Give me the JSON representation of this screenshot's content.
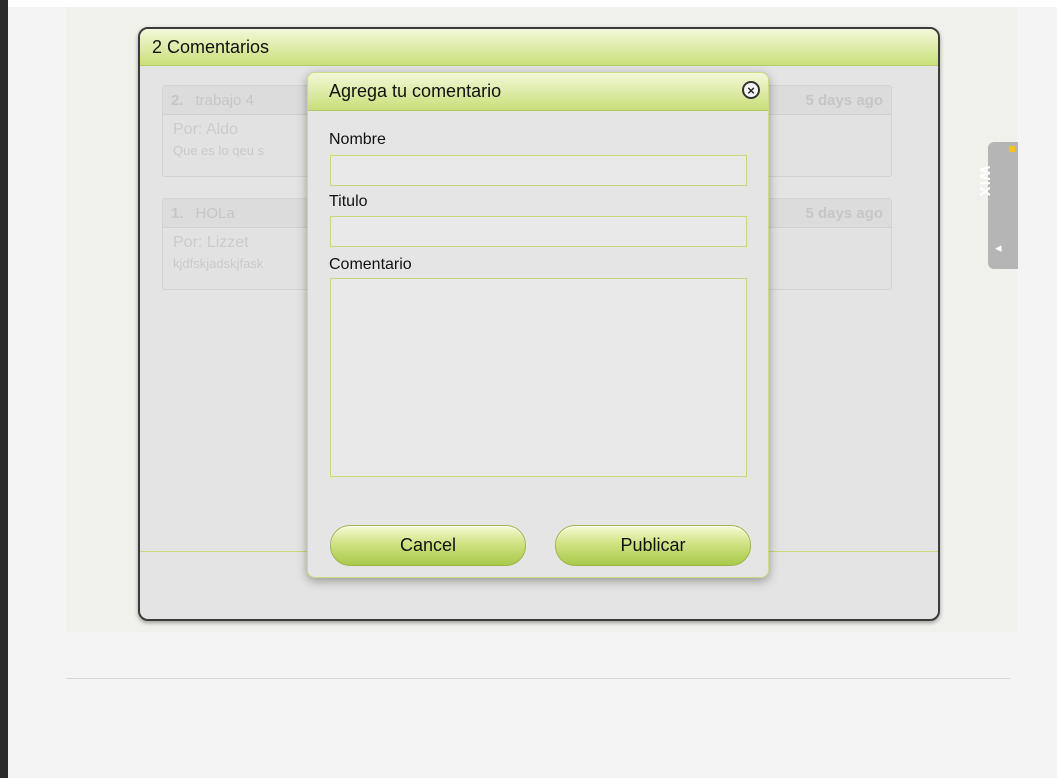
{
  "comments_panel": {
    "title": "2 Comentarios",
    "comments": [
      {
        "number": "2.",
        "title": "trabajo 4",
        "date": "5 days ago",
        "author": "Por: Aldo",
        "text": "Que es lo qeu s"
      },
      {
        "number": "1.",
        "title": "HOLa",
        "date": "5 days ago",
        "author": "Por: Lizzet",
        "text": "kjdfskjadskjfask"
      }
    ]
  },
  "modal": {
    "title": "Agrega tu comentario",
    "close_icon": "×",
    "fields": {
      "nombre_label": "Nombre",
      "nombre_value": "",
      "titulo_label": "Titulo",
      "titulo_value": "",
      "comentario_label": "Comentario",
      "comentario_value": ""
    },
    "cancel_label": "Cancel",
    "publish_label": "Publicar"
  },
  "wix_tab": {
    "logo": "WIX",
    "bubble_icon": "◂"
  },
  "colors": {
    "accent_green": "#c9e07a",
    "border_dark": "#3b3b3b",
    "panel_bg": "#e4e4e4"
  }
}
